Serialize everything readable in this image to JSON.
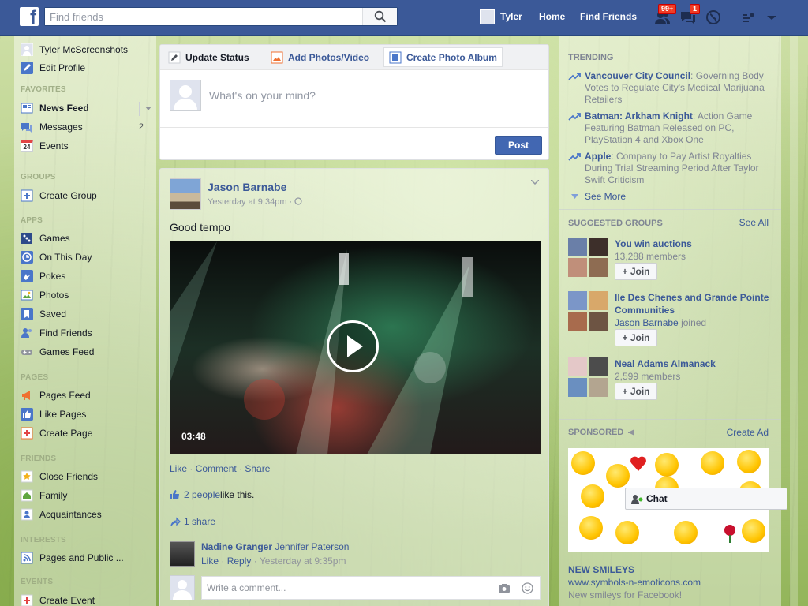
{
  "colors": {
    "brand": "#3b5998",
    "badge": "#f03d25",
    "post_button": "#4267b2"
  },
  "topbar": {
    "logo": "f",
    "search_placeholder": "Find friends",
    "user_name": "Tyler",
    "home": "Home",
    "find_friends": "Find Friends",
    "friend_requests_badge": "99+",
    "messages_badge": "1"
  },
  "leftnav": {
    "profile_name": "Tyler McScreenshots",
    "edit_profile": "Edit Profile",
    "sections": {
      "favorites": "FAVORITES",
      "groups": "GROUPS",
      "apps": "APPS",
      "pages": "PAGES",
      "friends": "FRIENDS",
      "interests": "INTERESTS",
      "events": "EVENTS"
    },
    "news_feed": "News Feed",
    "messages": "Messages",
    "messages_count": "2",
    "events": "Events",
    "events_icon_day": "24",
    "create_group": "Create Group",
    "games": "Games",
    "on_this_day": "On This Day",
    "pokes": "Pokes",
    "photos": "Photos",
    "saved": "Saved",
    "find_friends": "Find Friends",
    "games_feed": "Games Feed",
    "pages_feed": "Pages Feed",
    "like_pages": "Like Pages",
    "create_page": "Create Page",
    "close_friends": "Close Friends",
    "family": "Family",
    "acquaintances": "Acquaintances",
    "pages_and_public": "Pages and Public ...",
    "create_event": "Create Event"
  },
  "composer": {
    "tab_update_status": "Update Status",
    "tab_add_photos": "Add Photos/Video",
    "tab_create_album": "Create Photo Album",
    "placeholder": "What's on your mind?",
    "post_label": "Post"
  },
  "story": {
    "author": "Jason Barnabe",
    "time": "Yesterday at 9:34pm · ",
    "text": "Good tempo",
    "video_duration": "03:48",
    "like": "Like",
    "comment": "Comment",
    "share": "Share",
    "dot": " · ",
    "likes_link": "2 people",
    "likes_suffix": " like this.",
    "shares": "1 share",
    "commenter": "Nadine Granger",
    "comment_text": " Jennifer Paterson",
    "comment_like": "Like",
    "comment_reply": "Reply",
    "comment_time": "Yesterday at 9:35pm",
    "comment_placeholder": "Write a comment..."
  },
  "trending": {
    "header": "TRENDING",
    "items": [
      {
        "topic": "Vancouver City Council",
        "desc": ": Governing Body Votes to Regulate City's Medical Marijuana Retailers"
      },
      {
        "topic": "Batman: Arkham Knight",
        "desc": ": Action Game Featuring Batman Released on PC, PlayStation 4 and Xbox One"
      },
      {
        "topic": "Apple",
        "desc": ": Company to Pay Artist Royalties During Trial Streaming Period After Taylor Swift Criticism"
      }
    ],
    "see_more": "See More"
  },
  "suggested_groups": {
    "header": "SUGGESTED GROUPS",
    "see_all": "See All",
    "join": "Join",
    "items": [
      {
        "name": "You win auctions",
        "meta": "13,288 members"
      },
      {
        "name": "Ile Des Chenes and Grande Pointe Communities",
        "meta_link": "Jason Barnabe",
        "meta": " joined"
      },
      {
        "name": "Neal Adams Almanack",
        "meta": "2,599 members"
      }
    ]
  },
  "sponsored": {
    "header": "SPONSORED",
    "create_ad": "Create Ad",
    "title": "NEW SMILEYS",
    "url": "www.symbols-n-emoticons.com",
    "desc": "New smileys for Facebook!"
  },
  "chat": {
    "label": "Chat"
  }
}
